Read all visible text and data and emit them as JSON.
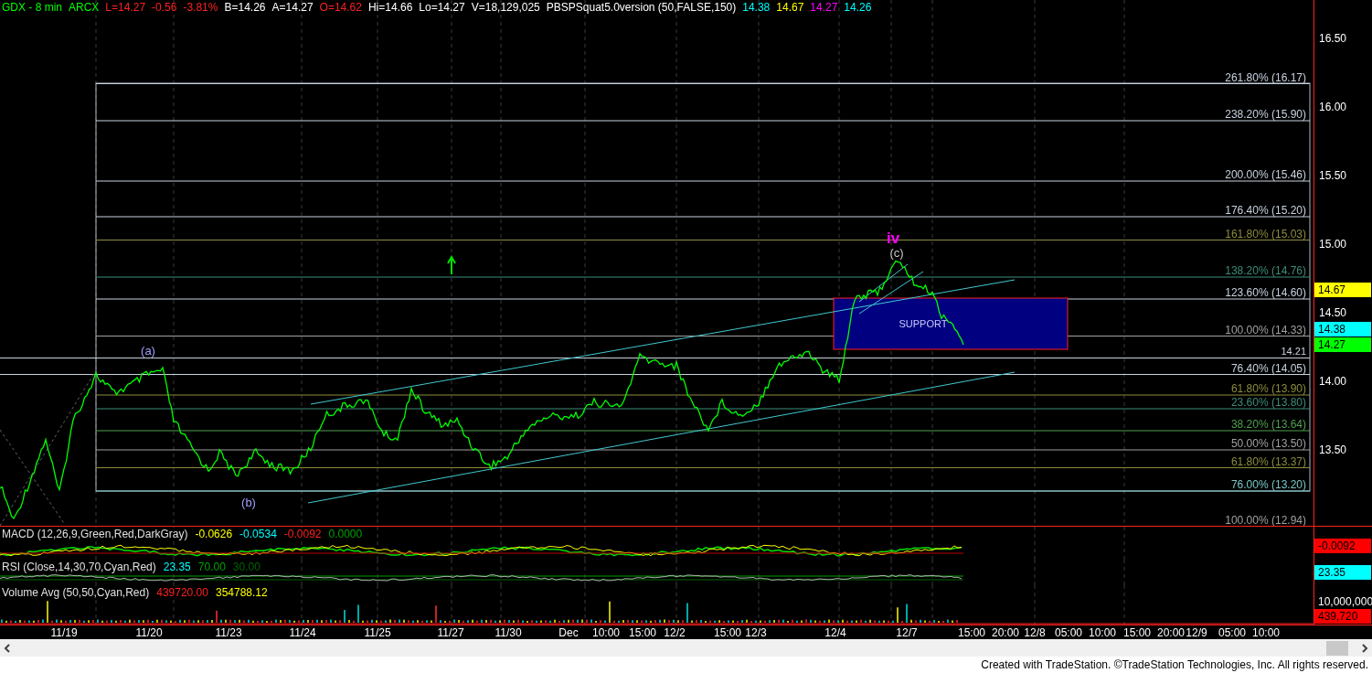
{
  "header": {
    "fields": [
      {
        "text": "GDX - 8 min",
        "color": "#00ff00"
      },
      {
        "text": "ARCX",
        "color": "#00ff00"
      },
      {
        "text": "L=14.27",
        "color": "#ff2020"
      },
      {
        "text": "-0.56",
        "color": "#ff2020"
      },
      {
        "text": "-3.81%",
        "color": "#ff2020"
      },
      {
        "text": "B=14.26",
        "color": "#ffffff"
      },
      {
        "text": "A=14.27",
        "color": "#ffffff"
      },
      {
        "text": "O=14.62",
        "color": "#ff2020"
      },
      {
        "text": "Hi=14.66",
        "color": "#ffffff"
      },
      {
        "text": "Lo=14.27",
        "color": "#ffffff"
      },
      {
        "text": "V=18,129,025",
        "color": "#ffffff"
      },
      {
        "text": "PBSPSquat5.0version (50,FALSE,150)",
        "color": "#ffffff"
      },
      {
        "text": "14.38",
        "color": "#00ffff"
      },
      {
        "text": "14.67",
        "color": "#ffff00"
      },
      {
        "text": "14.27",
        "color": "#ff00ff"
      },
      {
        "text": "14.26",
        "color": "#00ffff"
      }
    ]
  },
  "price_pane": {
    "wave_labels": [
      {
        "text": "(a)",
        "color": "#a0a0ff"
      },
      {
        "text": "(b)",
        "color": "#a0a0ff"
      },
      {
        "text": "iv",
        "color": "#ff00ff"
      },
      {
        "text": "(c)",
        "color": "#c8c8c8"
      }
    ],
    "support_label": "SUPPORT",
    "fib_levels": [
      {
        "label": "261.80% (16.17)",
        "color": "#c8d2e0"
      },
      {
        "label": "238.20% (15.90)",
        "color": "#c8d2e0"
      },
      {
        "label": "200.00% (15.46)",
        "color": "#c8d2e0"
      },
      {
        "label": "176.40% (15.20)",
        "color": "#c8d2e0"
      },
      {
        "label": "161.80% (15.03)",
        "color": "#8c8c3c"
      },
      {
        "label": "138.20% (14.76)",
        "color": "#3c8c78"
      },
      {
        "label": "123.60% (14.60)",
        "color": "#c8d2e0"
      },
      {
        "label": "100.00% (14.33)",
        "color": "#a0a0a0"
      },
      {
        "label": "76.40% (14.05)",
        "color": "#c8d2e0"
      },
      {
        "label": "61.80% (13.90)",
        "color": "#8c8c3c"
      },
      {
        "label": "23.60% (13.80)",
        "color": "#3c8c78"
      },
      {
        "label": "38.20% (13.64)",
        "color": "#50a050"
      },
      {
        "label": "50.00% (13.50)",
        "color": "#a0a0a0"
      },
      {
        "label": "61.80% (13.37)",
        "color": "#8c8c3c"
      },
      {
        "label": "76.00% (13.20)",
        "color": "#78c8c8"
      },
      {
        "label": "100.00% (12.94)",
        "color": "#a0a0a0"
      }
    ],
    "reference_line": "14.21",
    "axis_ticks": [
      "16.50",
      "16.00",
      "15.50",
      "15.00",
      "14.50",
      "14.00",
      "13.50"
    ],
    "markers": [
      {
        "value": "14.67",
        "color": "#ffff00"
      },
      {
        "value": "14.38",
        "color": "#00ffff"
      },
      {
        "value": "14.27",
        "color": "#00ff00"
      }
    ]
  },
  "macd": {
    "title": "MACD (12,26,9,Green,Red,DarkGray)",
    "values": [
      {
        "text": "-0.0626",
        "color": "#ffff00"
      },
      {
        "text": "-0.0534",
        "color": "#00ffff"
      },
      {
        "text": "-0.0092",
        "color": "#ff2020"
      },
      {
        "text": "0.0000",
        "color": "#00a000"
      }
    ],
    "marker": {
      "value": "-0.0092",
      "color": "#ff0000"
    }
  },
  "rsi": {
    "title": "RSI (Close,14,30,70,Cyan,Red)",
    "values": [
      {
        "text": "23.35",
        "color": "#00ffff"
      },
      {
        "text": "70.00",
        "color": "#00a000"
      },
      {
        "text": "30.00",
        "color": "#006400"
      }
    ],
    "marker": {
      "value": "23.35",
      "color": "#00ffff"
    }
  },
  "volume": {
    "title": "Volume Avg (50,50,Cyan,Red)",
    "values": [
      {
        "text": "439720.00",
        "color": "#ff2020"
      },
      {
        "text": "354788.12",
        "color": "#ffff00"
      }
    ],
    "axis_tick": "10,000,000",
    "marker": {
      "value": "439,720",
      "color": "#ff0000"
    }
  },
  "time_axis": [
    "11/19",
    "11/20",
    "11/23",
    "11/24",
    "11/25",
    "11/27",
    "11/30",
    "Dec",
    "10:00",
    "15:00",
    "12/2",
    "15:00",
    "12/3",
    "12/4",
    "12/7",
    "15:00",
    "20:00",
    "12/8",
    "05:00",
    "10:00",
    "15:00",
    "20:00",
    "12/9",
    "05:00",
    "10:00"
  ],
  "footer": "Created with TradeStation. ©TradeStation Technologies, Inc. All rights reserved."
}
